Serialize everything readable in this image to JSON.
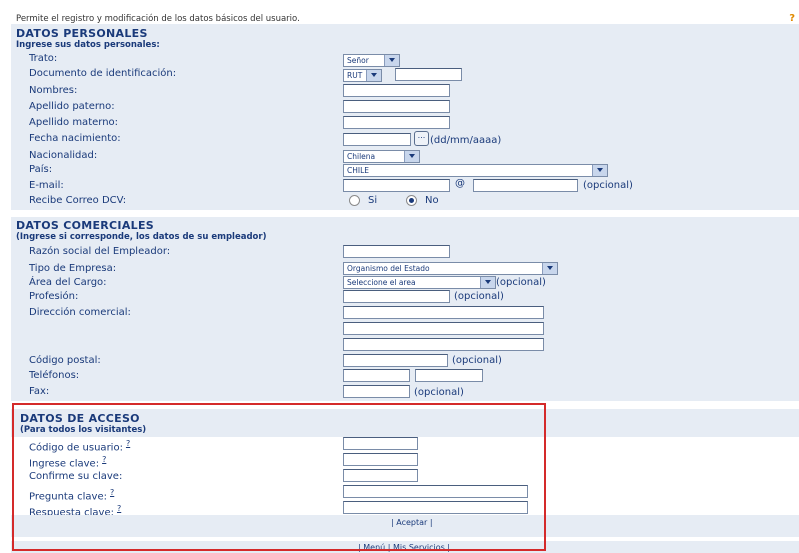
{
  "intro_text": "Permite el registro y modificación de los datos básicos del usuario.",
  "help_top": "?",
  "personal": {
    "title": "DATOS PERSONALES",
    "subtitle": "Ingrese sus datos personales:",
    "trato_label": "Trato:",
    "trato_value": "Señor",
    "documento_label": "Documento de identificación:",
    "documento_type": "RUT",
    "nombres_label": "Nombres:",
    "apellido_paterno_label": "Apellido paterno:",
    "apellido_materno_label": "Apellido materno:",
    "fecha_label": "Fecha nacimiento:",
    "fecha_button": "...",
    "fecha_hint": "(dd/mm/aaaa)",
    "nacionalidad_label": "Nacionalidad:",
    "nacionalidad_value": "Chilena",
    "pais_label": "País:",
    "pais_value": "CHILE",
    "email_label": "E-mail:",
    "email_at": "@",
    "email_optional": "(opcional)",
    "correo_label": "Recibe Correo DCV:",
    "correo_si": "Si",
    "correo_no": "No",
    "correo_selected": "No"
  },
  "commercial": {
    "title": "DATOS COMERCIALES",
    "subtitle": "(Ingrese si corresponde, los datos de su empleador)",
    "razon_label": "Razón social del Empleador:",
    "tipo_label": "Tipo de Empresa:",
    "tipo_value": "Organismo del Estado",
    "area_label": "Área del Cargo:",
    "area_value": "Seleccione el area",
    "area_optional": "(opcional)",
    "profesion_label": "Profesión:",
    "profesion_optional": "(opcional)",
    "direccion_label": "Dirección comercial:",
    "postal_label": "Código postal:",
    "postal_optional": "(opcional)",
    "telefonos_label": "Teléfonos:",
    "fax_label": "Fax:",
    "fax_optional": "(opcional)"
  },
  "access": {
    "title": "DATOS DE ACCESO",
    "subtitle": "(Para todos los visitantes)",
    "usuario_label": "Código de usuario:",
    "clave_label": "Ingrese clave:",
    "confirme_label": "Confirme su clave:",
    "pregunta_label": "Pregunta clave:",
    "respuesta_label": "Respuesta clave:",
    "help_mark": "?",
    "aceptar": "| Aceptar |",
    "footer_links": "| Menú | Mis Servicios |"
  },
  "colors": {
    "band": "#e6ecf4",
    "text": "#1a3a7a",
    "highlight_border": "#d42a2a"
  }
}
